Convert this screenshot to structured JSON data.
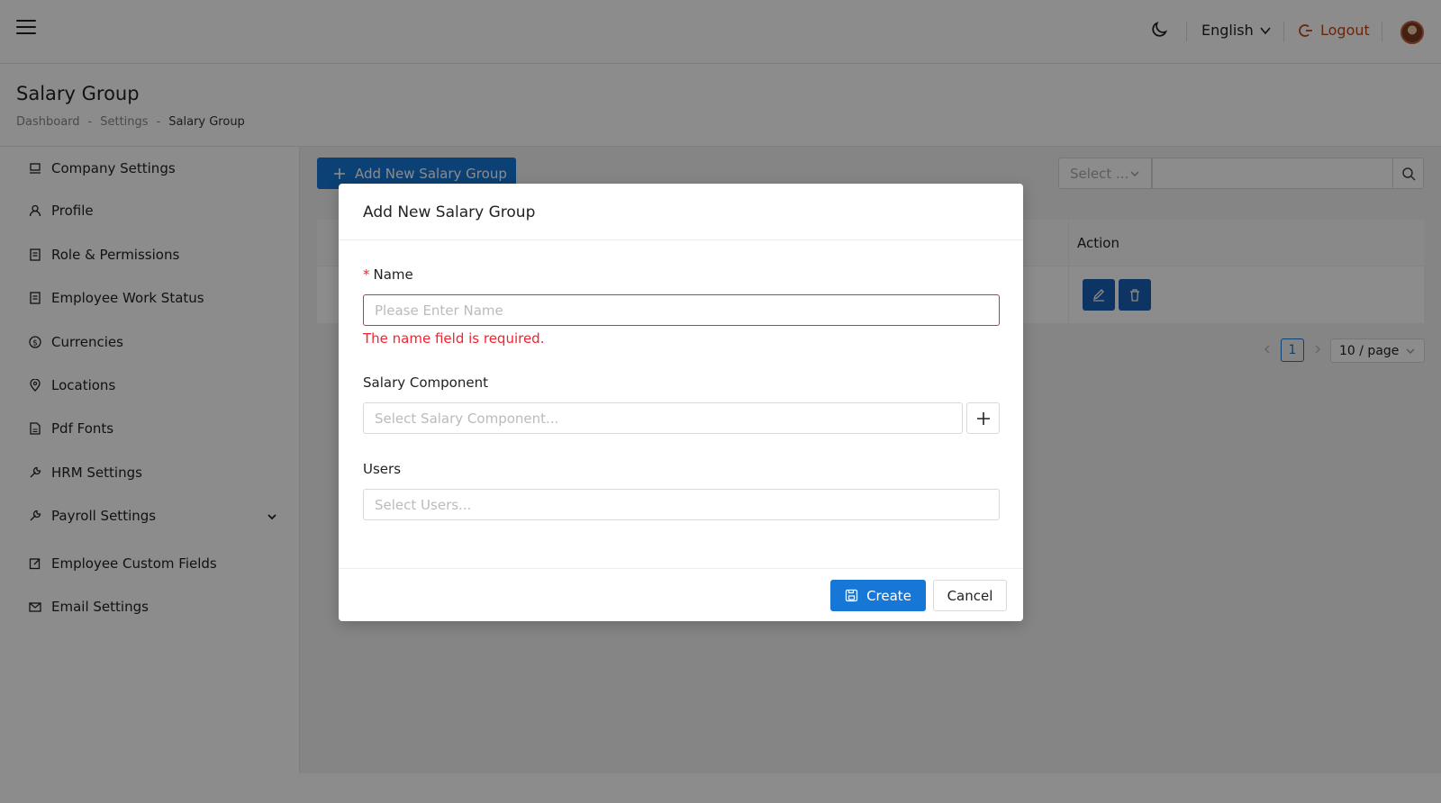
{
  "header": {
    "language": "English",
    "logout_label": "Logout",
    "icons": [
      "hamburger-icon",
      "moon-icon",
      "chevron-down-icon",
      "logout-icon",
      "avatar"
    ]
  },
  "page": {
    "title": "Salary Group",
    "breadcrumb": [
      "Dashboard",
      "Settings",
      "Salary Group"
    ]
  },
  "sidebar": {
    "items": [
      {
        "label": "Company Settings",
        "icon": "laptop-icon"
      },
      {
        "label": "Profile",
        "icon": "user-icon"
      },
      {
        "label": "Role & Permissions",
        "icon": "document-icon"
      },
      {
        "label": "Employee Work Status",
        "icon": "document-icon"
      },
      {
        "label": "Currencies",
        "icon": "dollar-icon"
      },
      {
        "label": "Locations",
        "icon": "location-pin-icon"
      },
      {
        "label": "Pdf Fonts",
        "icon": "file-icon"
      },
      {
        "label": "HRM Settings",
        "icon": "wrench-icon"
      },
      {
        "label": "Payroll Settings",
        "icon": "wrench-icon"
      },
      {
        "label": "Employee Custom Fields",
        "icon": "edit-icon"
      },
      {
        "label": "Email Settings",
        "icon": "mail-icon"
      }
    ]
  },
  "toolbar": {
    "add_label": "Add New Salary Group",
    "select_placeholder": "Select ..."
  },
  "table": {
    "action_header": "Action"
  },
  "pagination": {
    "current_page": "1",
    "page_size": "10 / page"
  },
  "modal": {
    "title": "Add New Salary Group",
    "name_label": "Name",
    "name_placeholder": "Please Enter Name",
    "name_error": "The name field is required.",
    "component_label": "Salary Component",
    "component_placeholder": "Select Salary Component...",
    "users_label": "Users",
    "users_placeholder": "Select Users...",
    "create_label": "Create",
    "cancel_label": "Cancel"
  },
  "colors": {
    "primary": "#1677d6",
    "error": "#f5222d",
    "logout": "#c0441a"
  }
}
